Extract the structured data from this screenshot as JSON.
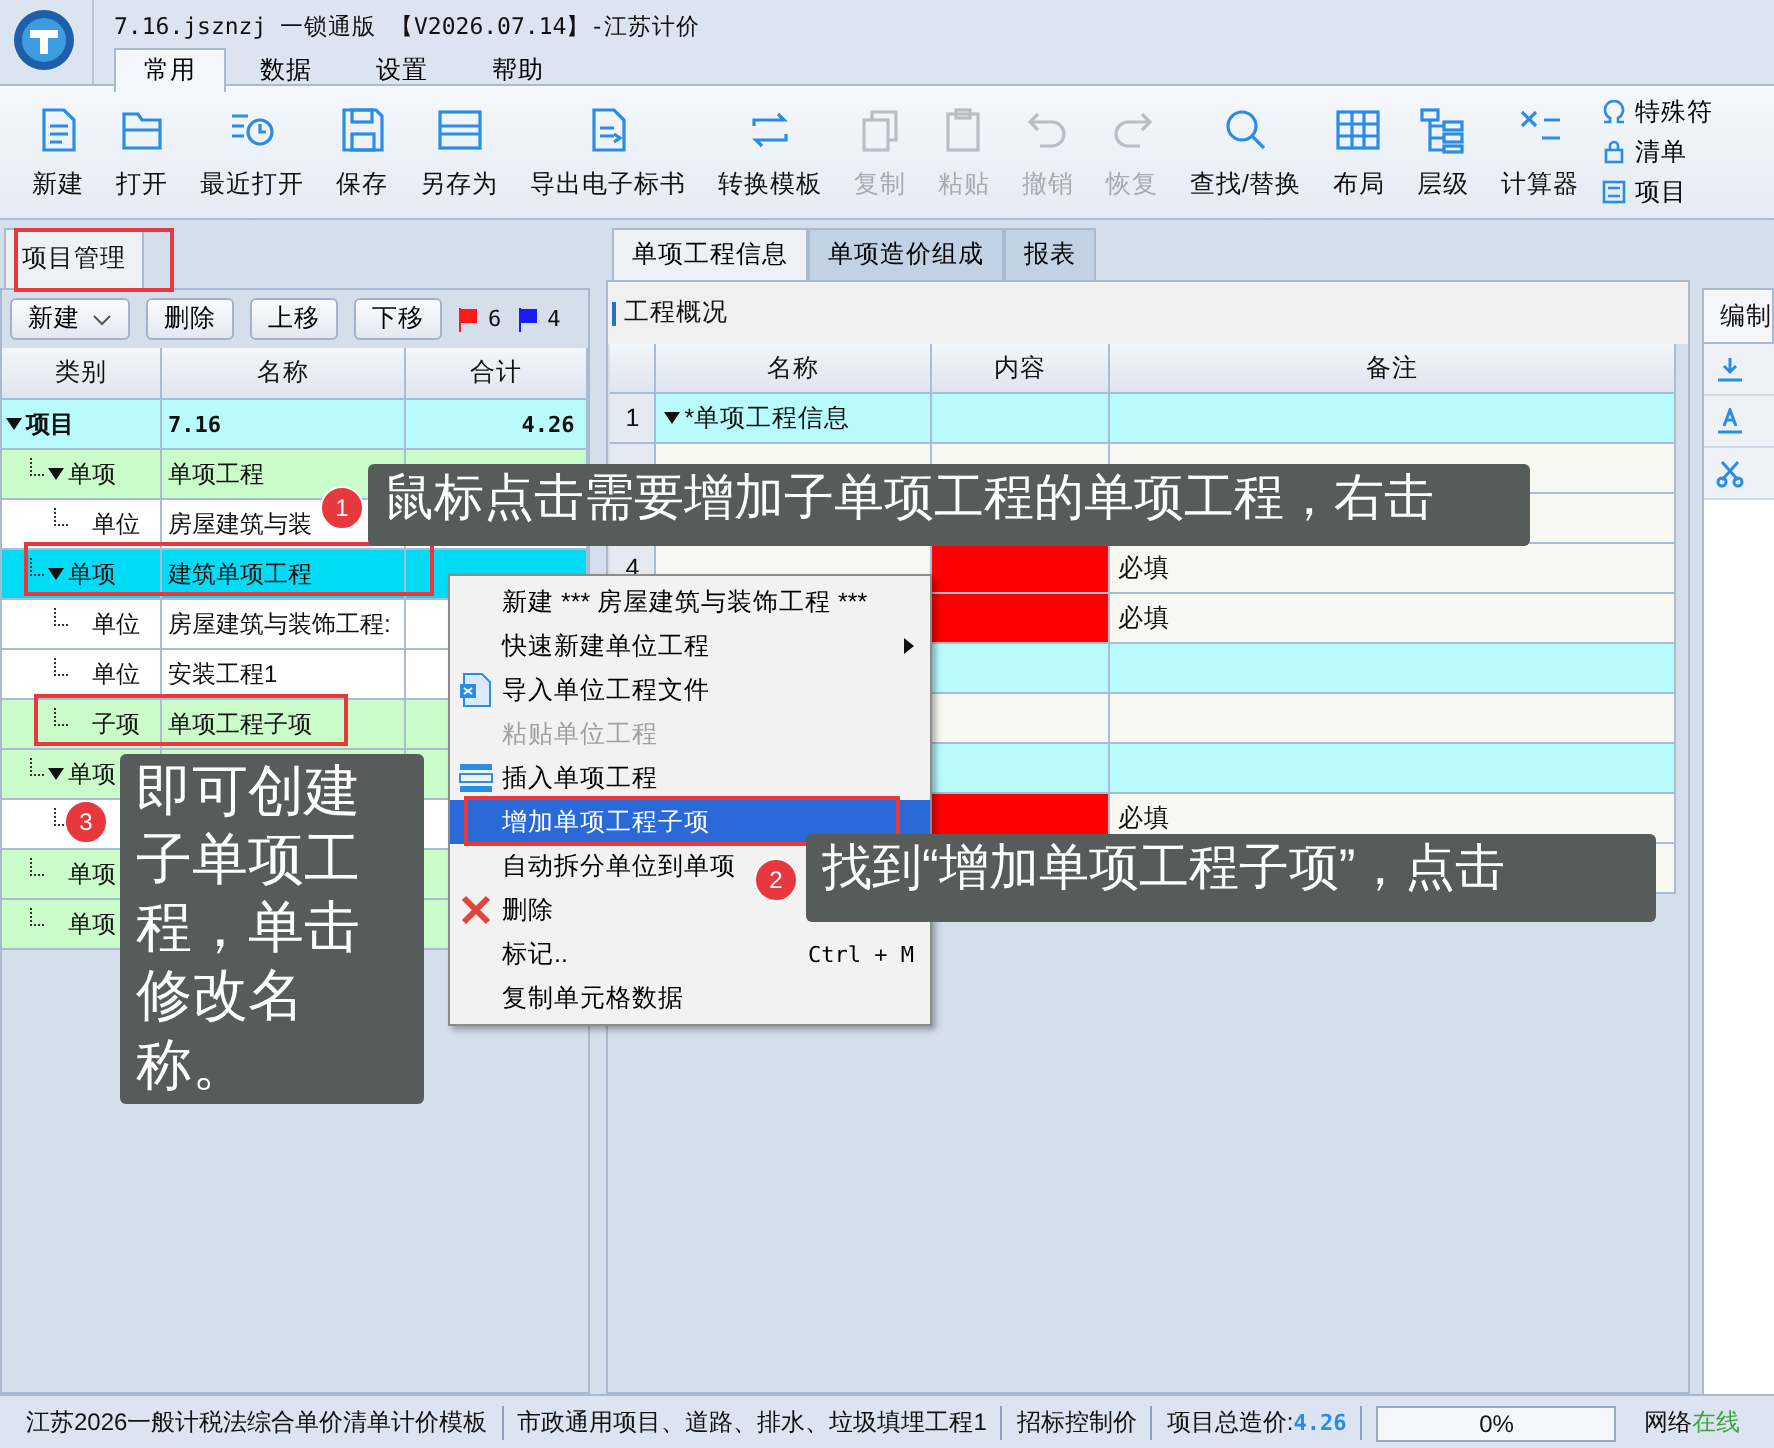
{
  "window": {
    "title": "7.16.jsznzj 一锁通版 【V2026.07.14】-江苏计价"
  },
  "menu_tabs": [
    {
      "label": "常用",
      "selected": true
    },
    {
      "label": "数据",
      "selected": false
    },
    {
      "label": "设置",
      "selected": false
    },
    {
      "label": "帮助",
      "selected": false
    }
  ],
  "toolbar": [
    {
      "label": "新建",
      "disabled": false
    },
    {
      "label": "打开",
      "disabled": false
    },
    {
      "label": "最近打开",
      "disabled": false
    },
    {
      "label": "保存",
      "disabled": false
    },
    {
      "label": "另存为",
      "disabled": false
    },
    {
      "label": "导出电子标书",
      "disabled": false
    },
    {
      "label": "转换模板",
      "disabled": false
    },
    {
      "label": "复制",
      "disabled": true
    },
    {
      "label": "粘贴",
      "disabled": true
    },
    {
      "label": "撤销",
      "disabled": true
    },
    {
      "label": "恢复",
      "disabled": true
    },
    {
      "label": "查找/替换",
      "disabled": false
    },
    {
      "label": "布局",
      "disabled": false
    },
    {
      "label": "层级",
      "disabled": false
    },
    {
      "label": "计算器",
      "disabled": false
    }
  ],
  "side_tools": [
    "特殊符",
    "清单",
    "项目"
  ],
  "project_panel": {
    "tab": "项目管理",
    "buttons": [
      {
        "label": "新建",
        "kind": "dropdown"
      },
      {
        "label": "删除",
        "kind": "button"
      },
      {
        "label": "上移",
        "kind": "button"
      },
      {
        "label": "下移",
        "kind": "button"
      }
    ],
    "flags": [
      {
        "count": "6",
        "color": "#ff1a1a"
      },
      {
        "count": "4",
        "color": "#1a1aff"
      }
    ],
    "columns": [
      "类别",
      "名称",
      "合计"
    ],
    "tree": [
      {
        "category": "项目",
        "name": "7.16",
        "total": "4.26",
        "kind": "project",
        "selected": false,
        "expanded": true,
        "children": [
          {
            "category": "单项",
            "name": "单项工程",
            "kind": "single",
            "selected": false,
            "expanded": true,
            "children": [
              {
                "category": "单位",
                "name": "房屋建筑与装",
                "kind": "unit",
                "selected": false
              }
            ]
          },
          {
            "category": "单项",
            "name": "建筑单项工程",
            "kind": "single",
            "selected": true,
            "expanded": true,
            "children": [
              {
                "category": "单位",
                "name": "房屋建筑与装饰工程:",
                "kind": "unit",
                "selected": false
              },
              {
                "category": "单位",
                "name": "安装工程1",
                "kind": "unit",
                "selected": false
              },
              {
                "category": "子项",
                "name": "单项工程子项",
                "kind": "sub",
                "selected": false
              }
            ]
          },
          {
            "category": "单项",
            "kind": "single",
            "selected": false,
            "expanded": true,
            "children": [
              {
                "kind": "unit",
                "selected": false
              }
            ]
          },
          {
            "category": "单项",
            "kind": "single",
            "selected": false
          },
          {
            "category": "单项",
            "kind": "single",
            "selected": false
          }
        ]
      }
    ]
  },
  "info_panel": {
    "tabs": [
      {
        "label": "单项工程信息",
        "selected": true
      },
      {
        "label": "单项造价组成",
        "selected": false
      },
      {
        "label": "报表",
        "selected": false
      }
    ],
    "section": "工程概况",
    "columns": [
      "名称",
      "内容",
      "备注"
    ],
    "rows": [
      {
        "number": "1",
        "name": "*单项工程信息",
        "kind": "group",
        "expanded": true,
        "children": [
          {
            "kind": "field",
            "required": false
          },
          {
            "kind": "field"
          },
          {
            "number": "4",
            "kind": "field",
            "required": true,
            "note": "必填"
          },
          {
            "kind": "field",
            "required": true,
            "note": "必填"
          }
        ]
      },
      {
        "kind": "group",
        "children": [
          {
            "kind": "field",
            "required": false
          }
        ]
      },
      {
        "kind": "group",
        "children": [
          {
            "kind": "field",
            "required": true,
            "note": "必填"
          },
          {
            "kind": "field"
          }
        ]
      }
    ]
  },
  "right_panel": {
    "tab": "编制"
  },
  "context_menu": [
    {
      "label": "新建 *** 房屋建筑与装饰工程 ***",
      "kind": "plain",
      "disabled": false,
      "selected": false
    },
    {
      "label": "快速新建单位工程",
      "kind": "submenu",
      "disabled": false,
      "selected": false
    },
    {
      "label": "导入单位工程文件",
      "kind": "file",
      "disabled": false,
      "selected": false
    },
    {
      "label": "粘贴单位工程",
      "kind": "plain",
      "disabled": true,
      "selected": false
    },
    {
      "label": "插入单项工程",
      "kind": "insert",
      "disabled": false,
      "selected": false
    },
    {
      "label": "增加单项工程子项",
      "kind": "plain",
      "disabled": false,
      "selected": true
    },
    {
      "label": "自动拆分单位到单项",
      "kind": "plain",
      "disabled": false,
      "selected": false
    },
    {
      "label": "删除",
      "kind": "delete",
      "disabled": false,
      "selected": false
    },
    {
      "label": "标记..",
      "kind": "plain",
      "disabled": false,
      "selected": false,
      "shortcut": "Ctrl + M"
    },
    {
      "label": "复制单元格数据",
      "kind": "plain",
      "disabled": false,
      "selected": false
    }
  ],
  "callouts": [
    {
      "number": "1",
      "text": "鼠标点击需要增加子单项工程的单项工程，右击"
    },
    {
      "number": "3",
      "text": "即可创建子单项工程，单击修改名称。"
    },
    {
      "number": "2",
      "text": "找到“增加单项工程子项”，点击"
    }
  ],
  "status_bar": {
    "template": "江苏2026一般计税法综合单价清单计价模板",
    "project_type": "市政通用项目、道路、排水、垃圾填埋工程1",
    "price_type": "招标控制价",
    "total_label": "项目总造价:",
    "total": "4.26",
    "progress": {
      "level": 0,
      "reading": "0%"
    },
    "network_label": "网络",
    "network_status": "在线"
  }
}
